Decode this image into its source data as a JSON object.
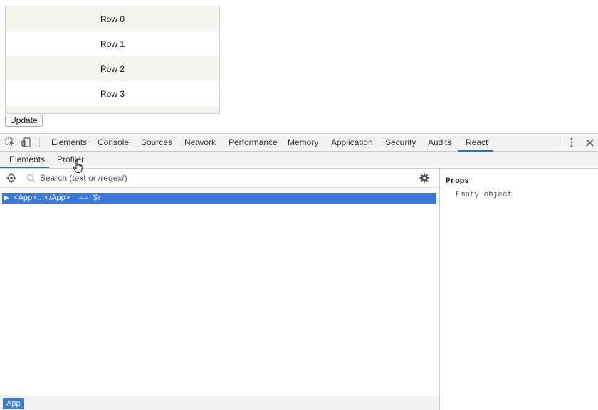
{
  "page": {
    "rows": [
      "Row 0",
      "Row 1",
      "Row 2",
      "Row 3",
      ""
    ],
    "update_label": "Update"
  },
  "devtools": {
    "tabs": [
      "Elements",
      "Console",
      "Sources",
      "Network",
      "Performance",
      "Memory",
      "Application",
      "Security",
      "Audits",
      "React"
    ],
    "active_tab": "React",
    "accent": "#1a73e8",
    "selection_color": "#3879d9",
    "react": {
      "subtabs": [
        "Elements",
        "Profiler"
      ],
      "active_subtab": "Elements",
      "search_placeholder": "Search (text or /regex/)",
      "tree": {
        "arrow": "▶",
        "node": "<App>…</App>",
        "suffix": "== $r"
      },
      "breadcrumb": "App",
      "props": {
        "title": "Props",
        "empty": "Empty object"
      }
    }
  }
}
